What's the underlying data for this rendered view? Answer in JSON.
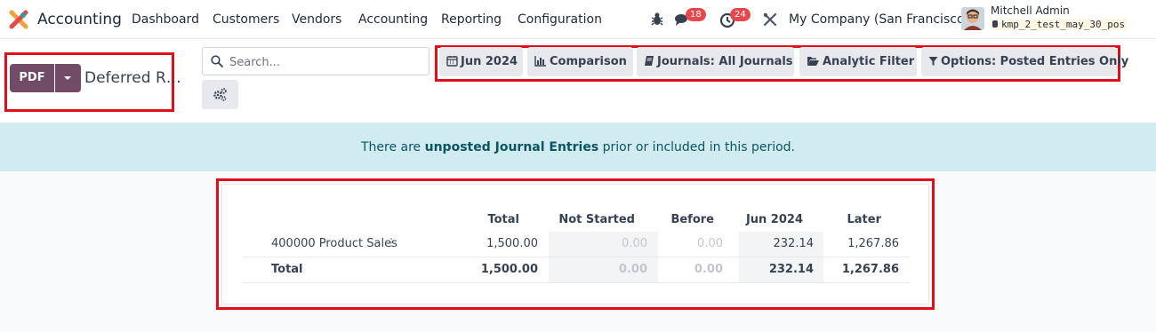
{
  "navbar": {
    "app_name": "Accounting",
    "menus": [
      "Dashboard",
      "Customers",
      "Vendors",
      "Accounting",
      "Reporting",
      "Configuration"
    ],
    "messages_count": "18",
    "activities_count": "24",
    "company": "My Company (San Francisco)",
    "user_name": "Mitchell Admin",
    "database": "kmp_2_test_may_30_pos"
  },
  "control_panel": {
    "pdf_label": "PDF",
    "report_title": "Deferred R…",
    "search_placeholder": "Search...",
    "filters": {
      "date": "Jun 2024",
      "comparison": "Comparison",
      "journals": "Journals: All Journals",
      "analytic": "Analytic Filter",
      "options": "Options: Posted Entries Only"
    }
  },
  "alert": {
    "prefix": "There are ",
    "link": "unposted Journal Entries",
    "suffix": " prior or included in this period."
  },
  "report": {
    "columns": [
      "Total",
      "Not Started",
      "Before",
      "Jun 2024",
      "Later"
    ],
    "rows": [
      {
        "label": "400000 Product Sales",
        "total": "1,500.00",
        "not_started": "0.00",
        "before": "0.00",
        "jun_2024": "232.14",
        "later": "1,267.86"
      },
      {
        "label": "Total",
        "total": "1,500.00",
        "not_started": "0.00",
        "before": "0.00",
        "jun_2024": "232.14",
        "later": "1,267.86"
      }
    ]
  },
  "colors": {
    "primary": "#714b67",
    "highlight_border": "#e10d1b",
    "alert_bg": "#d1ecf1",
    "badge": "#e5484d"
  }
}
